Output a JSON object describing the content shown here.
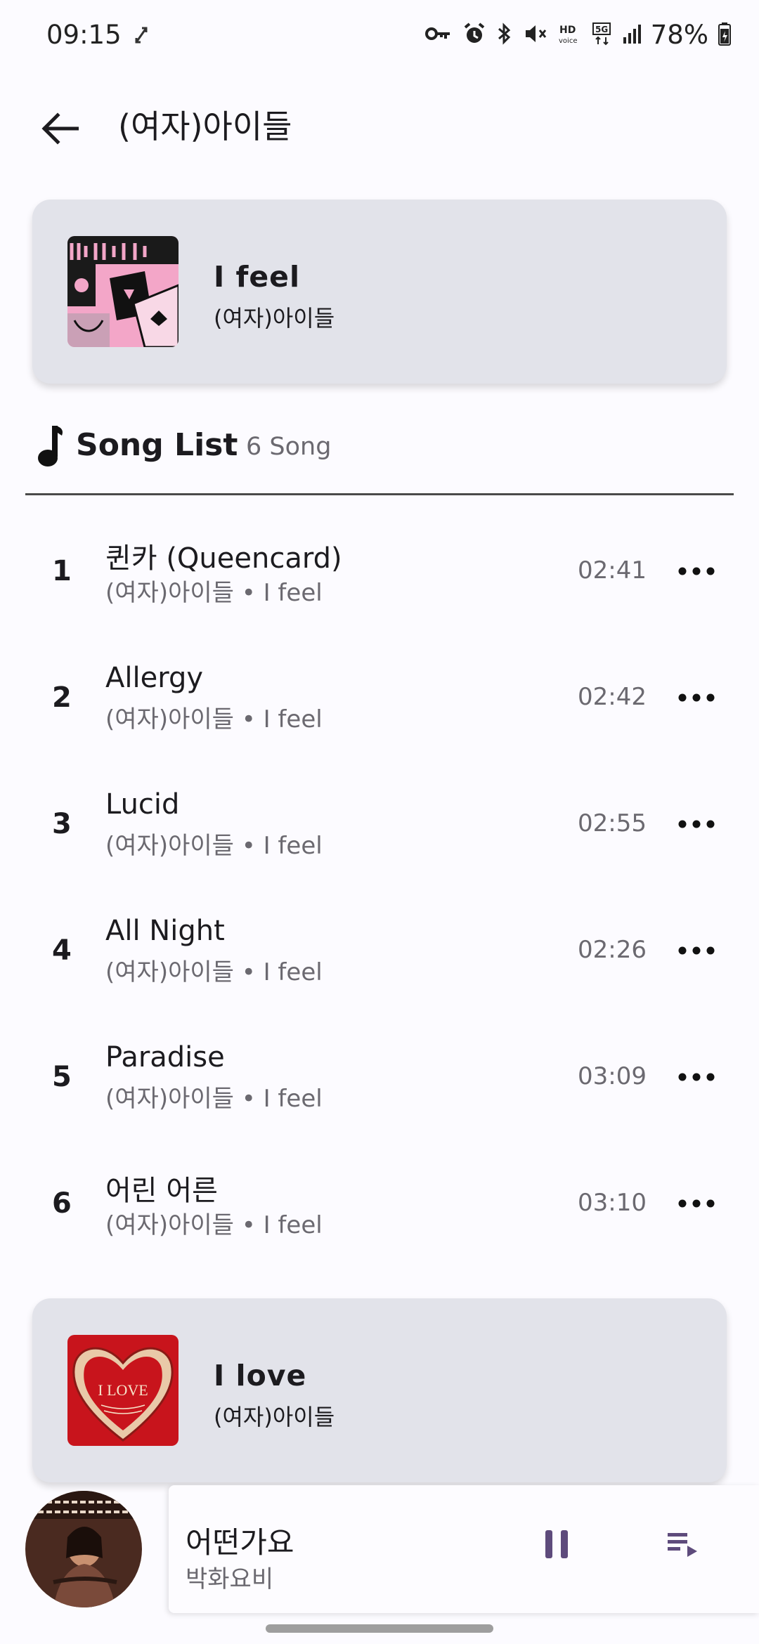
{
  "status_bar": {
    "time": "09:15",
    "battery": "78%",
    "icons": [
      "vpn-key-icon",
      "alarm-icon",
      "bluetooth-icon",
      "mute-icon",
      "hd-voice-icon",
      "5g-icon",
      "signal-icon",
      "battery-icon"
    ]
  },
  "app_bar": {
    "title": "(여자)아이들"
  },
  "albums": [
    {
      "title": "I feel",
      "artist": "(여자)아이들",
      "art_color": "#f3a6c8"
    },
    {
      "title": "I love",
      "artist": "(여자)아이들",
      "art_color": "#c8141c"
    }
  ],
  "album_art_text": {
    "i_love": "I LOVE"
  },
  "song_list": {
    "title": "Song List",
    "count": "6 Song",
    "songs": [
      {
        "num": "1",
        "title": "퀸카 (Queencard)",
        "sub": "(여자)아이들 • I feel",
        "duration": "02:41"
      },
      {
        "num": "2",
        "title": "Allergy",
        "sub": "(여자)아이들 • I feel",
        "duration": "02:42"
      },
      {
        "num": "3",
        "title": "Lucid",
        "sub": "(여자)아이들 • I feel",
        "duration": "02:55"
      },
      {
        "num": "4",
        "title": "All Night",
        "sub": "(여자)아이들 • I feel",
        "duration": "02:26"
      },
      {
        "num": "5",
        "title": "Paradise",
        "sub": "(여자)아이들 • I feel",
        "duration": "03:09"
      },
      {
        "num": "6",
        "title": "어린 어른",
        "sub": "(여자)아이들 • I feel",
        "duration": "03:10"
      }
    ]
  },
  "mini_player": {
    "title": "어떤가요",
    "artist": "박화요비"
  },
  "colors": {
    "card_bg": "#e2e3ea",
    "accent": "#5e4b7c",
    "background": "#fcfbff"
  }
}
